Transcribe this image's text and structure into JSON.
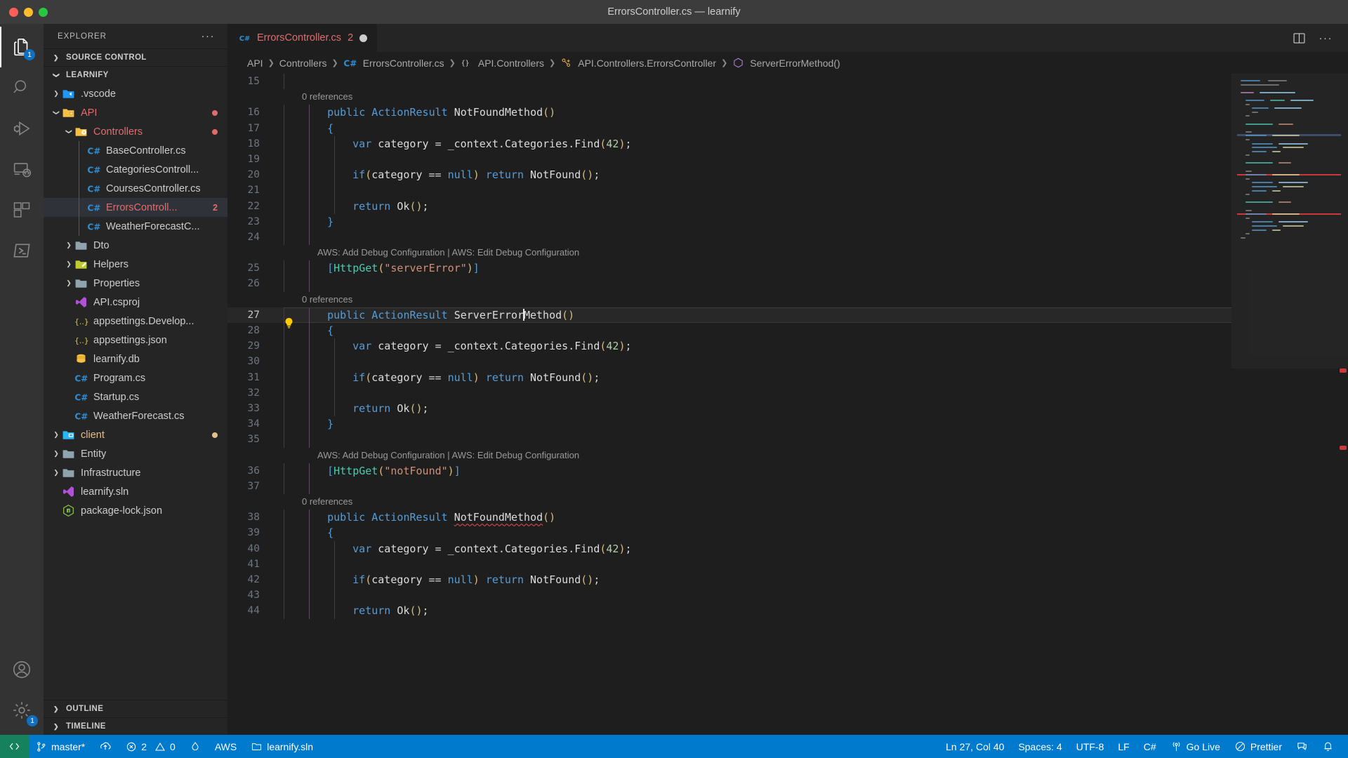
{
  "window": {
    "title": "ErrorsController.cs — learnify"
  },
  "traffic": {
    "close": "close-window",
    "minimize": "minimize-window",
    "maximize": "maximize-window"
  },
  "activitybar": {
    "items": [
      {
        "name": "explorer",
        "icon": "files-icon",
        "badge": "1",
        "active": true
      },
      {
        "name": "search",
        "icon": "search-icon",
        "badge": ""
      },
      {
        "name": "run-and-debug",
        "icon": "debug-icon",
        "badge": ""
      },
      {
        "name": "remote-explorer",
        "icon": "remote-icon",
        "badge": ""
      },
      {
        "name": "extensions",
        "icon": "extensions-icon",
        "badge": ""
      },
      {
        "name": "aws-toolkit",
        "icon": "aws-icon",
        "badge": ""
      }
    ],
    "bottom": [
      {
        "name": "accounts",
        "icon": "account-icon",
        "badge": ""
      },
      {
        "name": "manage-settings",
        "icon": "gear-icon",
        "badge": "1"
      }
    ]
  },
  "sidebar": {
    "header": {
      "title": "EXPLORER",
      "more": "···"
    },
    "sections": [
      {
        "label": "SOURCE CONTROL",
        "expanded": false
      },
      {
        "label": "OUTLINE",
        "expanded": false
      },
      {
        "label": "TIMELINE",
        "expanded": false
      }
    ],
    "root": {
      "label": "LEARNIFY",
      "expanded": true
    },
    "tree": [
      {
        "label": ".vscode",
        "indent": 1,
        "icon": "vscode-folder-icon",
        "arrow": "right",
        "color": "normal",
        "badge": "",
        "dot": ""
      },
      {
        "label": "API",
        "indent": 1,
        "icon": "api-folder-icon",
        "arrow": "down",
        "color": "red",
        "badge": "",
        "dot": "#e06c6c"
      },
      {
        "label": "Controllers",
        "indent": 2,
        "icon": "gear-folder-icon",
        "arrow": "down",
        "color": "red",
        "badge": "",
        "dot": "#e06c6c"
      },
      {
        "label": "BaseController.cs",
        "indent": 3,
        "icon": "csharp-icon",
        "arrow": "none",
        "color": "normal",
        "badge": "",
        "dot": ""
      },
      {
        "label": "CategoriesControll...",
        "indent": 3,
        "icon": "csharp-icon",
        "arrow": "none",
        "color": "normal",
        "badge": "",
        "dot": ""
      },
      {
        "label": "CoursesController.cs",
        "indent": 3,
        "icon": "csharp-icon",
        "arrow": "none",
        "color": "normal",
        "badge": "",
        "dot": ""
      },
      {
        "label": "ErrorsControll...",
        "indent": 3,
        "icon": "csharp-icon",
        "arrow": "none",
        "color": "red",
        "badge": "2",
        "dot": "",
        "selected": true
      },
      {
        "label": "WeatherForecastC...",
        "indent": 3,
        "icon": "csharp-icon",
        "arrow": "none",
        "color": "normal",
        "badge": "",
        "dot": ""
      },
      {
        "label": "Dto",
        "indent": 2,
        "icon": "folder-icon",
        "arrow": "right",
        "color": "normal",
        "badge": "",
        "dot": ""
      },
      {
        "label": "Helpers",
        "indent": 2,
        "icon": "helpers-folder-icon",
        "arrow": "right",
        "color": "normal",
        "badge": "",
        "dot": ""
      },
      {
        "label": "Properties",
        "indent": 2,
        "icon": "folder-icon",
        "arrow": "right",
        "color": "normal",
        "badge": "",
        "dot": ""
      },
      {
        "label": "API.csproj",
        "indent": 2,
        "icon": "visualstudio-icon",
        "arrow": "none",
        "color": "normal",
        "badge": "",
        "dot": ""
      },
      {
        "label": "appsettings.Develop...",
        "indent": 2,
        "icon": "json-icon",
        "arrow": "none",
        "color": "normal",
        "badge": "",
        "dot": ""
      },
      {
        "label": "appsettings.json",
        "indent": 2,
        "icon": "json-icon",
        "arrow": "none",
        "color": "normal",
        "badge": "",
        "dot": ""
      },
      {
        "label": "learnify.db",
        "indent": 2,
        "icon": "database-icon",
        "arrow": "none",
        "color": "normal",
        "badge": "",
        "dot": ""
      },
      {
        "label": "Program.cs",
        "indent": 2,
        "icon": "csharp-icon",
        "arrow": "none",
        "color": "normal",
        "badge": "",
        "dot": ""
      },
      {
        "label": "Startup.cs",
        "indent": 2,
        "icon": "csharp-icon",
        "arrow": "none",
        "color": "normal",
        "badge": "",
        "dot": ""
      },
      {
        "label": "WeatherForecast.cs",
        "indent": 2,
        "icon": "csharp-icon",
        "arrow": "none",
        "color": "normal",
        "badge": "",
        "dot": ""
      },
      {
        "label": "client",
        "indent": 1,
        "icon": "client-folder-icon",
        "arrow": "right",
        "color": "modified",
        "badge": "",
        "dot": "#e2c08d"
      },
      {
        "label": "Entity",
        "indent": 1,
        "icon": "folder-icon",
        "arrow": "right",
        "color": "normal",
        "badge": "",
        "dot": ""
      },
      {
        "label": "Infrastructure",
        "indent": 1,
        "icon": "folder-icon",
        "arrow": "right",
        "color": "normal",
        "badge": "",
        "dot": ""
      },
      {
        "label": "learnify.sln",
        "indent": 1,
        "icon": "visualstudio-icon",
        "arrow": "none",
        "color": "normal",
        "badge": "",
        "dot": ""
      },
      {
        "label": "package-lock.json",
        "indent": 1,
        "icon": "npm-icon",
        "arrow": "none",
        "color": "normal",
        "badge": "",
        "dot": ""
      }
    ]
  },
  "tabs": [
    {
      "label": "ErrorsController.cs",
      "icon": "csharp-icon",
      "errors": "2",
      "dirty": true,
      "active": true
    }
  ],
  "tab_actions": {
    "split": "split-editor-icon",
    "more": "···"
  },
  "breadcrumbs": [
    {
      "label": "API",
      "icon": ""
    },
    {
      "label": "Controllers",
      "icon": ""
    },
    {
      "label": "ErrorsController.cs",
      "icon": "csharp-icon"
    },
    {
      "label": "API.Controllers",
      "icon": "namespace-icon"
    },
    {
      "label": "API.Controllers.ErrorsController",
      "icon": "class-icon"
    },
    {
      "label": "ServerErrorMethod()",
      "icon": "method-icon"
    }
  ],
  "editor": {
    "cursor_line": 27,
    "lens_references": "0 references",
    "lens_aws": "AWS: Add Debug Configuration | AWS: Edit Debug Configuration",
    "lines": [
      {
        "n": 15,
        "tokens": []
      },
      {
        "lens": "refs"
      },
      {
        "n": 16,
        "tokens": [
          {
            "t": "public ",
            "c": "kw"
          },
          {
            "t": "ActionResult ",
            "c": "cls"
          },
          {
            "t": "NotFoundMethod",
            "c": "white"
          },
          {
            "t": "()",
            "c": "par"
          }
        ],
        "indent": 1
      },
      {
        "n": 17,
        "tokens": [
          {
            "t": "{",
            "c": "kw"
          }
        ],
        "indent": 1
      },
      {
        "n": 18,
        "tokens": [
          {
            "t": "var ",
            "c": "kw"
          },
          {
            "t": "category ",
            "c": "white"
          },
          {
            "t": "= ",
            "c": "plain"
          },
          {
            "t": "_context",
            "c": "white"
          },
          {
            "t": ".",
            "c": "plain"
          },
          {
            "t": "Categories",
            "c": "white"
          },
          {
            "t": ".",
            "c": "plain"
          },
          {
            "t": "Find",
            "c": "white"
          },
          {
            "t": "(",
            "c": "par"
          },
          {
            "t": "42",
            "c": "num"
          },
          {
            "t": ")",
            "c": "par"
          },
          {
            "t": ";",
            "c": "plain"
          }
        ],
        "indent": 2
      },
      {
        "n": 19,
        "tokens": [],
        "indent": 2
      },
      {
        "n": 20,
        "tokens": [
          {
            "t": "if",
            "c": "kw"
          },
          {
            "t": "(",
            "c": "par"
          },
          {
            "t": "category ",
            "c": "white"
          },
          {
            "t": "== ",
            "c": "plain"
          },
          {
            "t": "null",
            "c": "kw"
          },
          {
            "t": ")",
            "c": "par"
          },
          {
            "t": " ",
            "c": "plain"
          },
          {
            "t": "return ",
            "c": "kw"
          },
          {
            "t": "NotFound",
            "c": "white"
          },
          {
            "t": "()",
            "c": "par"
          },
          {
            "t": ";",
            "c": "plain"
          }
        ],
        "indent": 2
      },
      {
        "n": 21,
        "tokens": [],
        "indent": 2
      },
      {
        "n": 22,
        "tokens": [
          {
            "t": "return ",
            "c": "kw"
          },
          {
            "t": "Ok",
            "c": "white"
          },
          {
            "t": "()",
            "c": "par"
          },
          {
            "t": ";",
            "c": "plain"
          }
        ],
        "indent": 2
      },
      {
        "n": 23,
        "tokens": [
          {
            "t": "}",
            "c": "kw"
          }
        ],
        "indent": 1
      },
      {
        "n": 24,
        "tokens": [],
        "indent": 1
      },
      {
        "lens": "aws"
      },
      {
        "n": 25,
        "tokens": [
          {
            "t": "[",
            "c": "kw"
          },
          {
            "t": "HttpGet",
            "c": "attr"
          },
          {
            "t": "(",
            "c": "par"
          },
          {
            "t": "\"serverError\"",
            "c": "str"
          },
          {
            "t": ")",
            "c": "par"
          },
          {
            "t": "]",
            "c": "kw"
          }
        ],
        "indent": 1
      },
      {
        "n": 26,
        "tokens": [],
        "indent": 1
      },
      {
        "lens": "refs"
      },
      {
        "n": 27,
        "tokens": [
          {
            "t": "public ",
            "c": "kw"
          },
          {
            "t": "ActionResult ",
            "c": "cls"
          },
          {
            "t": "ServerError",
            "c": "white"
          },
          {
            "t": "CARET",
            "c": "caret"
          },
          {
            "t": "Method",
            "c": "white"
          },
          {
            "t": "()",
            "c": "par"
          }
        ],
        "indent": 1,
        "active": true,
        "bulb": true
      },
      {
        "n": 28,
        "tokens": [
          {
            "t": "{",
            "c": "kw"
          }
        ],
        "indent": 1
      },
      {
        "n": 29,
        "tokens": [
          {
            "t": "var ",
            "c": "kw"
          },
          {
            "t": "category ",
            "c": "white"
          },
          {
            "t": "= ",
            "c": "plain"
          },
          {
            "t": "_context",
            "c": "white"
          },
          {
            "t": ".",
            "c": "plain"
          },
          {
            "t": "Categories",
            "c": "white"
          },
          {
            "t": ".",
            "c": "plain"
          },
          {
            "t": "Find",
            "c": "white"
          },
          {
            "t": "(",
            "c": "par"
          },
          {
            "t": "42",
            "c": "num"
          },
          {
            "t": ")",
            "c": "par"
          },
          {
            "t": ";",
            "c": "plain"
          }
        ],
        "indent": 2
      },
      {
        "n": 30,
        "tokens": [],
        "indent": 2
      },
      {
        "n": 31,
        "tokens": [
          {
            "t": "if",
            "c": "kw"
          },
          {
            "t": "(",
            "c": "par"
          },
          {
            "t": "category ",
            "c": "white"
          },
          {
            "t": "== ",
            "c": "plain"
          },
          {
            "t": "null",
            "c": "kw"
          },
          {
            "t": ")",
            "c": "par"
          },
          {
            "t": " ",
            "c": "plain"
          },
          {
            "t": "return ",
            "c": "kw"
          },
          {
            "t": "NotFound",
            "c": "white"
          },
          {
            "t": "()",
            "c": "par"
          },
          {
            "t": ";",
            "c": "plain"
          }
        ],
        "indent": 2
      },
      {
        "n": 32,
        "tokens": [],
        "indent": 2
      },
      {
        "n": 33,
        "tokens": [
          {
            "t": "return ",
            "c": "kw"
          },
          {
            "t": "Ok",
            "c": "white"
          },
          {
            "t": "()",
            "c": "par"
          },
          {
            "t": ";",
            "c": "plain"
          }
        ],
        "indent": 2
      },
      {
        "n": 34,
        "tokens": [
          {
            "t": "}",
            "c": "kw"
          }
        ],
        "indent": 1
      },
      {
        "n": 35,
        "tokens": [],
        "indent": 1
      },
      {
        "lens": "aws"
      },
      {
        "n": 36,
        "tokens": [
          {
            "t": "[",
            "c": "kw"
          },
          {
            "t": "HttpGet",
            "c": "attr"
          },
          {
            "t": "(",
            "c": "par"
          },
          {
            "t": "\"notFound\"",
            "c": "str"
          },
          {
            "t": ")",
            "c": "par"
          },
          {
            "t": "]",
            "c": "kw"
          }
        ],
        "indent": 1
      },
      {
        "n": 37,
        "tokens": [],
        "indent": 1
      },
      {
        "lens": "refs"
      },
      {
        "n": 38,
        "tokens": [
          {
            "t": "public ",
            "c": "kw"
          },
          {
            "t": "ActionResult ",
            "c": "cls"
          },
          {
            "t": "NotFoundMethod",
            "c": "white squig"
          },
          {
            "t": "()",
            "c": "par"
          }
        ],
        "indent": 1
      },
      {
        "n": 39,
        "tokens": [
          {
            "t": "{",
            "c": "kw"
          }
        ],
        "indent": 1
      },
      {
        "n": 40,
        "tokens": [
          {
            "t": "var ",
            "c": "kw"
          },
          {
            "t": "category ",
            "c": "white"
          },
          {
            "t": "= ",
            "c": "plain"
          },
          {
            "t": "_context",
            "c": "white"
          },
          {
            "t": ".",
            "c": "plain"
          },
          {
            "t": "Categories",
            "c": "white"
          },
          {
            "t": ".",
            "c": "plain"
          },
          {
            "t": "Find",
            "c": "white"
          },
          {
            "t": "(",
            "c": "par"
          },
          {
            "t": "42",
            "c": "num"
          },
          {
            "t": ")",
            "c": "par"
          },
          {
            "t": ";",
            "c": "plain"
          }
        ],
        "indent": 2
      },
      {
        "n": 41,
        "tokens": [],
        "indent": 2
      },
      {
        "n": 42,
        "tokens": [
          {
            "t": "if",
            "c": "kw"
          },
          {
            "t": "(",
            "c": "par"
          },
          {
            "t": "category ",
            "c": "white"
          },
          {
            "t": "== ",
            "c": "plain"
          },
          {
            "t": "null",
            "c": "kw"
          },
          {
            "t": ")",
            "c": "par"
          },
          {
            "t": " ",
            "c": "plain"
          },
          {
            "t": "return ",
            "c": "kw"
          },
          {
            "t": "NotFound",
            "c": "white"
          },
          {
            "t": "()",
            "c": "par"
          },
          {
            "t": ";",
            "c": "plain"
          }
        ],
        "indent": 2
      },
      {
        "n": 43,
        "tokens": [],
        "indent": 2
      },
      {
        "n": 44,
        "tokens": [
          {
            "t": "return ",
            "c": "kw"
          },
          {
            "t": "Ok",
            "c": "white"
          },
          {
            "t": "()",
            "c": "par"
          },
          {
            "t": ";",
            "c": "plain"
          }
        ],
        "indent": 2
      }
    ]
  },
  "statusbar": {
    "left": [
      {
        "name": "remote-indicator",
        "icon": "remote-icon",
        "label": ""
      },
      {
        "name": "branch",
        "icon": "branch-icon",
        "label": "master*"
      },
      {
        "name": "sync-changes",
        "icon": "sync-icon",
        "label": ""
      },
      {
        "name": "problems",
        "icon": "error-warning-icon",
        "label": "2  0",
        "errors": "2",
        "warnings": "0"
      },
      {
        "name": "radon",
        "icon": "flame-icon",
        "label": ""
      },
      {
        "name": "aws-connection",
        "icon": "",
        "label": "AWS"
      },
      {
        "name": "solution",
        "icon": "folder-icon",
        "label": "learnify.sln"
      }
    ],
    "right": [
      {
        "name": "cursor-position",
        "label": "Ln 27, Col 40"
      },
      {
        "name": "indentation",
        "label": "Spaces: 4"
      },
      {
        "name": "encoding",
        "label": "UTF-8"
      },
      {
        "name": "eol",
        "label": "LF"
      },
      {
        "name": "language-mode",
        "label": "C#"
      },
      {
        "name": "go-live",
        "icon": "broadcast-icon",
        "label": "Go Live"
      },
      {
        "name": "prettier",
        "icon": "prettier-icon",
        "label": "Prettier"
      },
      {
        "name": "feedback",
        "icon": "feedback-icon",
        "label": ""
      },
      {
        "name": "notifications",
        "icon": "bell-icon",
        "label": ""
      }
    ]
  },
  "colors": {
    "accent": "#007acc",
    "remote_green": "#16825d",
    "error_red": "#e06c6c",
    "modified_yellow": "#e2c08d",
    "editor_bg": "#1e1e1e",
    "sidebar_bg": "#252526",
    "activitybar_bg": "#333333"
  }
}
